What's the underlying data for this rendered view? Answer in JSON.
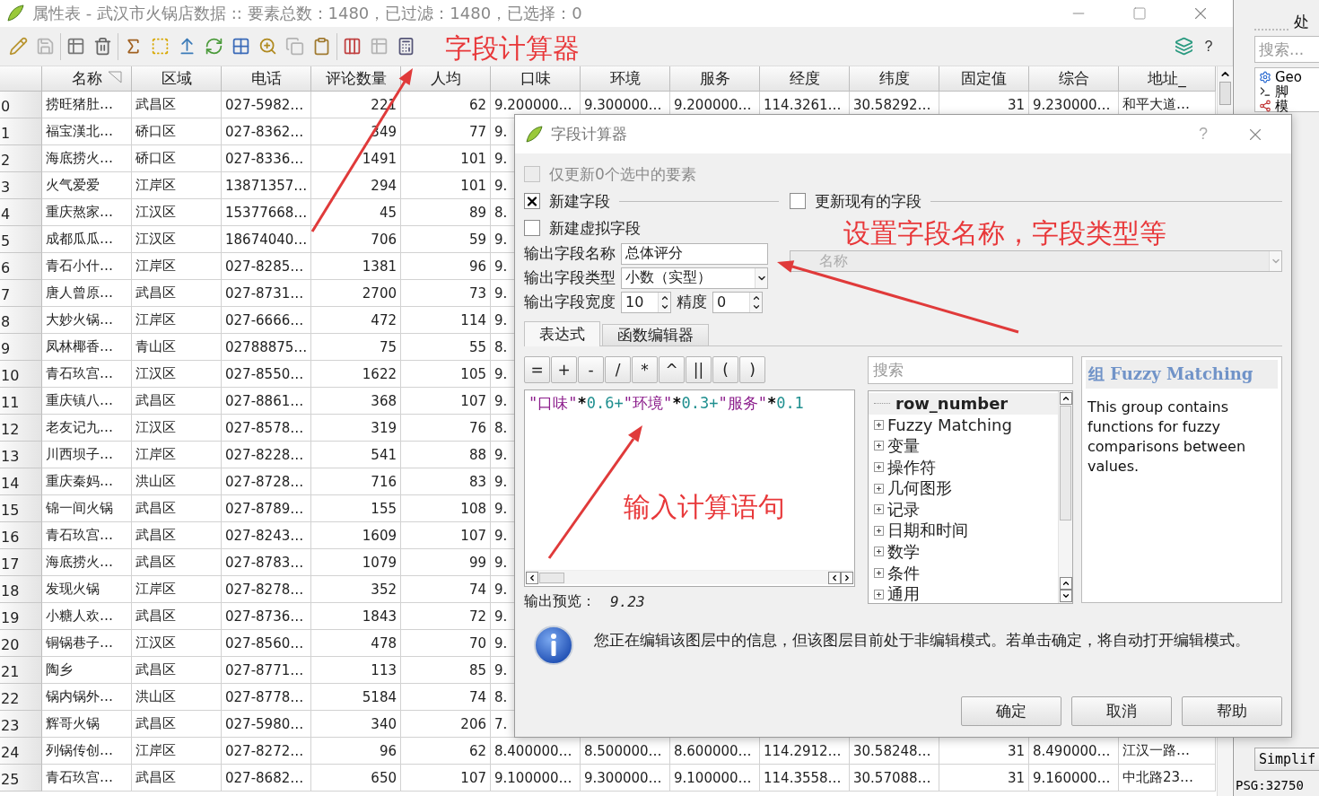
{
  "window": {
    "title": "属性表 - 武汉市火锅店数据 :: 要素总数：1480，已过滤：1480，已选择：0"
  },
  "toolbar": {
    "groups": [
      [
        {
          "kind": "edit",
          "disabled": false
        },
        {
          "kind": "save",
          "disabled": true
        }
      ],
      [
        {
          "kind": "delete-rows",
          "disabled": false
        },
        {
          "kind": "trash",
          "disabled": false
        }
      ],
      [
        {
          "kind": "expression",
          "disabled": false
        },
        {
          "kind": "select",
          "disabled": false
        },
        {
          "kind": "move-top",
          "disabled": false
        },
        {
          "kind": "invert",
          "disabled": false
        },
        {
          "kind": "filter",
          "disabled": false
        },
        {
          "kind": "zoom",
          "disabled": false
        },
        {
          "kind": "copy",
          "disabled": true
        },
        {
          "kind": "paste",
          "disabled": false
        }
      ],
      [
        {
          "kind": "delete-column",
          "disabled": false
        },
        {
          "kind": "new-column",
          "disabled": true
        },
        {
          "kind": "field-calculator",
          "disabled": false
        }
      ]
    ],
    "right": [
      {
        "kind": "organize",
        "disabled": false
      }
    ],
    "help": "?"
  },
  "table": {
    "columns": [
      {
        "label": "名称",
        "sorted": true,
        "numeric": false
      },
      {
        "label": "区域",
        "sorted": false,
        "numeric": false
      },
      {
        "label": "电话",
        "sorted": false,
        "numeric": false
      },
      {
        "label": "评论数量",
        "sorted": false,
        "numeric": true
      },
      {
        "label": "人均",
        "sorted": false,
        "numeric": true
      },
      {
        "label": "口味",
        "sorted": false,
        "numeric": false
      },
      {
        "label": "环境",
        "sorted": false,
        "numeric": false
      },
      {
        "label": "服务",
        "sorted": false,
        "numeric": false
      },
      {
        "label": "经度",
        "sorted": false,
        "numeric": false
      },
      {
        "label": "纬度",
        "sorted": false,
        "numeric": false
      },
      {
        "label": "固定值",
        "sorted": false,
        "numeric": true
      },
      {
        "label": "综合",
        "sorted": false,
        "numeric": false
      },
      {
        "label": "地址_",
        "sorted": false,
        "numeric": false
      }
    ],
    "rows": [
      {
        "number": "0",
        "cells": [
          "捞旺猪肚…",
          "武昌区",
          "027-5982…",
          "221",
          "62",
          "9.200000…",
          "9.300000…",
          "9.200000…",
          "114.3261…",
          "30.58292…",
          "31",
          "9.230000…",
          "和平大道…"
        ]
      },
      {
        "number": "1",
        "cells": [
          "福宝漢北…",
          "硚口区",
          "027-8362…",
          "349",
          "77",
          "9."
        ]
      },
      {
        "number": "2",
        "cells": [
          "海底捞火…",
          "硚口区",
          "027-8336…",
          "1491",
          "101",
          "9."
        ]
      },
      {
        "number": "3",
        "cells": [
          "火气爱爱",
          "江岸区",
          "13871357…",
          "294",
          "101",
          "9."
        ]
      },
      {
        "number": "4",
        "cells": [
          "重庆熬家…",
          "江汉区",
          "15377668…",
          "45",
          "89",
          "8."
        ]
      },
      {
        "number": "5",
        "cells": [
          "成都瓜瓜…",
          "江汉区",
          "18674040…",
          "706",
          "59",
          "9."
        ]
      },
      {
        "number": "6",
        "cells": [
          "青石小什…",
          "江岸区",
          "027-8285…",
          "1381",
          "96",
          "9."
        ]
      },
      {
        "number": "7",
        "cells": [
          "唐人曾原…",
          "武昌区",
          "027-8731…",
          "2700",
          "73",
          "9."
        ]
      },
      {
        "number": "8",
        "cells": [
          "大妙火锅…",
          "江岸区",
          "027-6666…",
          "472",
          "114",
          "9."
        ]
      },
      {
        "number": "9",
        "cells": [
          "凤林椰香…",
          "青山区",
          "02788875…",
          "75",
          "55",
          "8."
        ]
      },
      {
        "number": "10",
        "cells": [
          "青石玖宫…",
          "江汉区",
          "027-8550…",
          "1622",
          "105",
          "9."
        ]
      },
      {
        "number": "11",
        "cells": [
          "重庆镇八…",
          "武昌区",
          "027-8861…",
          "368",
          "107",
          "9."
        ]
      },
      {
        "number": "12",
        "cells": [
          "老友记九…",
          "江汉区",
          "027-8578…",
          "319",
          "76",
          "8."
        ]
      },
      {
        "number": "13",
        "cells": [
          "川西坝子…",
          "江岸区",
          "027-8228…",
          "541",
          "88",
          "9."
        ]
      },
      {
        "number": "14",
        "cells": [
          "重庆秦妈…",
          "洪山区",
          "027-8728…",
          "716",
          "83",
          "9."
        ]
      },
      {
        "number": "15",
        "cells": [
          "锦一间火锅",
          "武昌区",
          "027-8789…",
          "155",
          "108",
          "9."
        ]
      },
      {
        "number": "16",
        "cells": [
          "青石玖宫…",
          "武昌区",
          "027-8243…",
          "1609",
          "107",
          "9."
        ]
      },
      {
        "number": "17",
        "cells": [
          "海底捞火…",
          "武昌区",
          "027-8783…",
          "1079",
          "99",
          "9."
        ]
      },
      {
        "number": "18",
        "cells": [
          "发现火锅",
          "江岸区",
          "027-8278…",
          "352",
          "74",
          "9."
        ]
      },
      {
        "number": "19",
        "cells": [
          "小糖人欢…",
          "武昌区",
          "027-8736…",
          "1843",
          "72",
          "9."
        ]
      },
      {
        "number": "20",
        "cells": [
          "铜锅巷子…",
          "江汉区",
          "027-8560…",
          "478",
          "70",
          "9."
        ]
      },
      {
        "number": "21",
        "cells": [
          "陶乡",
          "武昌区",
          "027-8771…",
          "113",
          "85",
          "9."
        ]
      },
      {
        "number": "22",
        "cells": [
          "锅内锅外…",
          "洪山区",
          "027-8778…",
          "5184",
          "74",
          "8."
        ]
      },
      {
        "number": "23",
        "cells": [
          "辉哥火锅",
          "武昌区",
          "027-5980…",
          "340",
          "206",
          "7."
        ]
      },
      {
        "number": "24",
        "cells": [
          "列锅传创…",
          "江岸区",
          "027-8272…",
          "96",
          "62",
          "8.400000…",
          "8.500000…",
          "8.600000…",
          "114.2912…",
          "30.58248…",
          "31",
          "8.490000…",
          "江汉一路…"
        ]
      },
      {
        "number": "25",
        "cells": [
          "青石玖宫…",
          "武昌区",
          "027-8682…",
          "650",
          "107",
          "9.100000…",
          "9.300000…",
          "9.100000…",
          "114.3558…",
          "30.57088…",
          "31",
          "9.160000…",
          "中北路23…"
        ]
      }
    ]
  },
  "dialog": {
    "title": "字段计算器",
    "help": "?",
    "only_selected": {
      "label": "仅更新0个选中的要素",
      "checked": false,
      "disabled": true
    },
    "new_field": {
      "label": "新建字段",
      "checked": true
    },
    "update_existing": {
      "label": "更新现有的字段",
      "checked": false
    },
    "virtual_field": {
      "label": "新建虚拟字段",
      "checked": false
    },
    "name": {
      "label": "输出字段名称",
      "value": "总体评分"
    },
    "type": {
      "label": "输出字段类型",
      "value": "小数（实型）"
    },
    "width": {
      "label": "输出字段宽度",
      "value": "10"
    },
    "precision": {
      "label": "精度",
      "value": "0"
    },
    "existing_field": {
      "placeholder": "名称",
      "disabled": true
    },
    "tabs": [
      {
        "label": "表达式",
        "selected": true
      },
      {
        "label": "函数编辑器",
        "selected": false
      }
    ],
    "operators": [
      "=",
      "+",
      "-",
      "/",
      "*",
      "^",
      "||",
      "(",
      ")"
    ],
    "expression": [
      {
        "kind": "field",
        "text": "\"口味\""
      },
      {
        "kind": "multiply",
        "text": "*"
      },
      {
        "kind": "number",
        "text": "0.6"
      },
      {
        "kind": "plus",
        "text": "+"
      },
      {
        "kind": "field",
        "text": "\"环境\""
      },
      {
        "kind": "multiply",
        "text": "*"
      },
      {
        "kind": "number",
        "text": "0.3"
      },
      {
        "kind": "plus",
        "text": "+"
      },
      {
        "kind": "field",
        "text": "\"服务\""
      },
      {
        "kind": "multiply",
        "text": "*"
      },
      {
        "kind": "number",
        "text": "0.1"
      }
    ],
    "preview": {
      "label": "输出预览：",
      "value": "9.23"
    },
    "function_search": {
      "placeholder": "搜索"
    },
    "functions": [
      {
        "label": "row_number",
        "kind": "leaf",
        "highlighted": true
      },
      {
        "label": "Fuzzy Matching",
        "kind": "group",
        "expanded": false,
        "highlighted": false
      },
      {
        "label": "变量",
        "kind": "group",
        "expanded": false,
        "highlighted": false
      },
      {
        "label": "操作符",
        "kind": "group",
        "expanded": false,
        "highlighted": false
      },
      {
        "label": "几何图形",
        "kind": "group",
        "expanded": false,
        "highlighted": false
      },
      {
        "label": "记录",
        "kind": "group",
        "expanded": false,
        "highlighted": false
      },
      {
        "label": "日期和时间",
        "kind": "group",
        "expanded": false,
        "highlighted": false
      },
      {
        "label": "数学",
        "kind": "group",
        "expanded": false,
        "highlighted": false
      },
      {
        "label": "条件",
        "kind": "group",
        "expanded": false,
        "highlighted": false
      },
      {
        "label": "通用",
        "kind": "group",
        "expanded": false,
        "highlighted": false
      }
    ],
    "help_panel": {
      "title": "组 Fuzzy Matching",
      "text": "This group contains functions for fuzzy comparisons between values."
    },
    "message": "您正在编辑该图层中的信息，但该图层目前处于非编辑模式。若单击确定，将自动打开编辑模式。",
    "buttons": [
      "确定",
      "取消",
      "帮助"
    ]
  },
  "side_panel": {
    "title": "处",
    "search": {
      "placeholder": "搜索..."
    },
    "items": [
      {
        "label": "Geo",
        "kind": "gear"
      },
      {
        "label": "脚",
        "kind": "terminal"
      },
      {
        "label": "模",
        "kind": "model"
      }
    ],
    "button": "Simplif",
    "status": "PSG:32750"
  },
  "annotations": [
    {
      "text": "字段计算器"
    },
    {
      "text": "设置字段名称，字段类型等"
    },
    {
      "text": "输入计算语句"
    }
  ]
}
